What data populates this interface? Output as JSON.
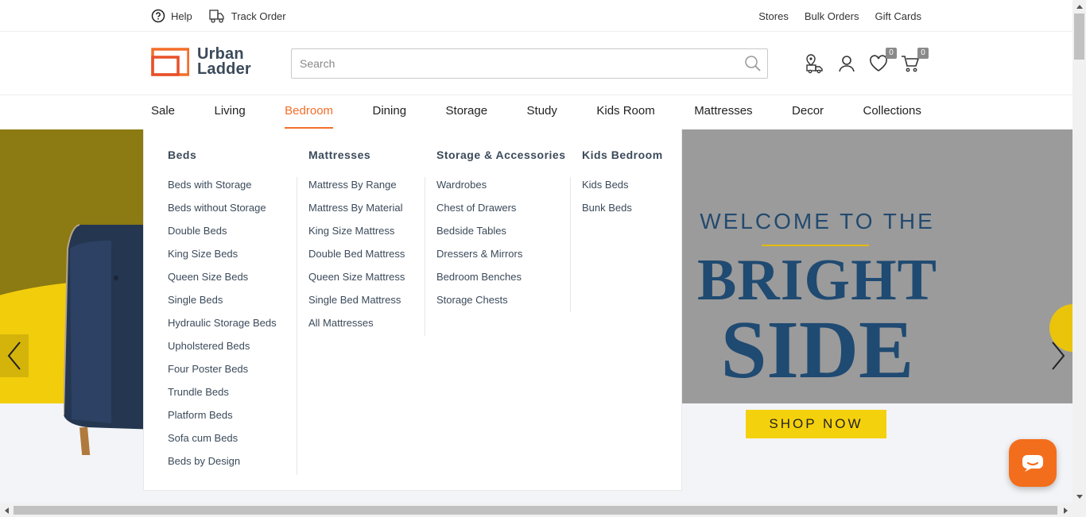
{
  "utility": {
    "help": "Help",
    "track_order": "Track Order",
    "stores": "Stores",
    "bulk_orders": "Bulk Orders",
    "gift_cards": "Gift Cards"
  },
  "header": {
    "logo_line1": "Urban",
    "logo_line2": "Ladder",
    "search_placeholder": "Search",
    "wishlist_count": "0",
    "cart_count": "0"
  },
  "nav": {
    "items": [
      "Sale",
      "Living",
      "Bedroom",
      "Dining",
      "Storage",
      "Study",
      "Kids Room",
      "Mattresses",
      "Decor",
      "Collections"
    ],
    "active": "Bedroom"
  },
  "mega_menu": {
    "columns": [
      {
        "heading": "Beds",
        "links": [
          "Beds with Storage",
          "Beds without Storage",
          "Double Beds",
          "King Size Beds",
          "Queen Size Beds",
          "Single Beds",
          "Hydraulic Storage Beds",
          "Upholstered Beds",
          "Four Poster Beds",
          "Trundle Beds",
          "Platform Beds",
          "Sofa cum Beds",
          "Beds by Design"
        ]
      },
      {
        "heading": "Mattresses",
        "links": [
          "Mattress By Range",
          "Mattress By Material",
          "King Size Mattress",
          "Double Bed Mattress",
          "Queen Size Mattress",
          "Single Bed Mattress",
          "All Mattresses"
        ]
      },
      {
        "heading": "Storage & Accessories",
        "links": [
          "Wardrobes",
          "Chest of Drawers",
          "Bedside Tables",
          "Dressers & Mirrors",
          "Bedroom Benches",
          "Storage Chests"
        ]
      },
      {
        "heading": "Kids Bedroom",
        "links": [
          "Kids Beds",
          "Bunk Beds"
        ]
      }
    ]
  },
  "hero": {
    "welcome": "WELCOME TO THE",
    "bright": "BRIGHT",
    "side": "SIDE",
    "cta": "SHOP NOW"
  },
  "colors": {
    "accent": "#f36e2a",
    "text_dark": "#3b4a5a",
    "hero_navy": "#1f4a72",
    "hero_yellow": "#f4d10d",
    "hero_olive": "#8c7a12"
  }
}
